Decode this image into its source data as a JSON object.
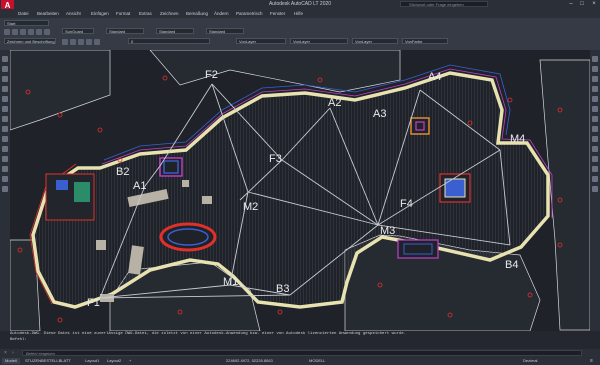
{
  "window": {
    "title": "Autodesk AutoCAD LT 2020",
    "search_placeholder": "Stichwort oder Frage eingeben",
    "min": "–",
    "max": "□",
    "close": "×"
  },
  "menu": [
    "Datei",
    "Bearbeiten",
    "Ansicht",
    "Einfügen",
    "Format",
    "Extras",
    "Zeichnen",
    "Bemaßung",
    "Ändern",
    "Parametrisch",
    "Fenster",
    "Hilfe"
  ],
  "ribbon": {
    "style_label": "Start",
    "textstyle": "SunGuard",
    "dimstyle": "Standard",
    "tablestyle": "Standard",
    "mlstyle": "Standard",
    "workspace": "Zeichnen und Beschriftung",
    "layer": "0",
    "color": "VonLayer",
    "linetype": "VonLayer",
    "lineweight": "VonLayer",
    "plotstyle": "VonFarbe"
  },
  "drawing": {
    "labels": [
      "F2",
      "A4",
      "A2",
      "A3",
      "M4",
      "F3",
      "B2",
      "A1",
      "M2",
      "F4",
      "M3",
      "B4",
      "M1",
      "B3",
      "F1"
    ],
    "colors": {
      "background": "#1f2329",
      "boundary": "#e8e2b0",
      "red": "#e0302c",
      "magenta": "#c23fc8",
      "blue": "#3a5fd0",
      "line": "#c8ccd2"
    }
  },
  "command": {
    "history_line1": "Autodesk-DWG. Diese Datei ist eine zuverlässige DWG-Datei, die zuletzt von einer Autodesk-Anwendung bzw. einer von Autodesk lizenzierten Anwendung gespeichert wurde.",
    "history_line2": "Befehl:",
    "input_placeholder": "Befehl eingeben"
  },
  "status": {
    "tabs": [
      "Modell",
      "STUZENBESTELLBLATT",
      "Layout1",
      "Layout2",
      "+"
    ],
    "coordinates": "224692.4972, 52228.8063",
    "mode": "MODELL",
    "units": "Dezimal"
  }
}
